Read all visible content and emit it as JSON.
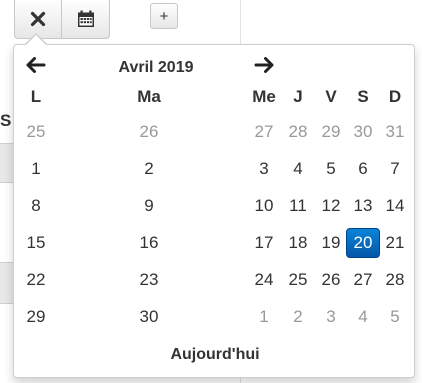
{
  "toolbar": {
    "clear_icon": "close-icon",
    "calendar_icon": "calendar-icon",
    "add_label": "+"
  },
  "background": {
    "peek_text": "S"
  },
  "datepicker": {
    "title": "Avril 2019",
    "prev_icon": "arrow-left-icon",
    "next_icon": "arrow-right-icon",
    "weekdays": [
      "L",
      "Ma",
      "Me",
      "J",
      "V",
      "S",
      "D"
    ],
    "weeks": [
      [
        "25",
        "26",
        "27",
        "28",
        "29",
        "30",
        "31"
      ],
      [
        "1",
        "2",
        "3",
        "4",
        "5",
        "6",
        "7"
      ],
      [
        "8",
        "9",
        "10",
        "11",
        "12",
        "13",
        "14"
      ],
      [
        "15",
        "16",
        "17",
        "18",
        "19",
        "20",
        "21"
      ],
      [
        "22",
        "23",
        "24",
        "25",
        "26",
        "27",
        "28"
      ],
      [
        "29",
        "30",
        "1",
        "2",
        "3",
        "4",
        "5"
      ]
    ],
    "selected_day": "20",
    "today_label": "Aujourd'hui",
    "colors": {
      "selected_top": "#0a84d8",
      "selected_bottom": "#0457a8",
      "muted_text": "#999999",
      "text": "#333333"
    }
  }
}
